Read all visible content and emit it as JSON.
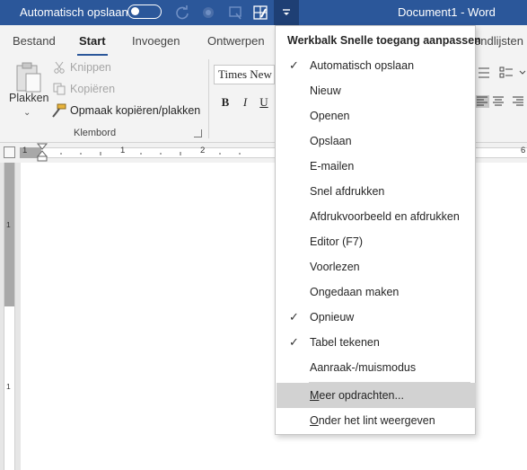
{
  "titlebar": {
    "autosave_label": "Automatisch opslaan",
    "autosave_state": "off",
    "document_title": "Document1  -  Word",
    "icons": [
      "redo-icon",
      "touch-mode-icon",
      "print-preview-icon",
      "table-draw-icon",
      "customize-qat-icon"
    ]
  },
  "ribbon": {
    "tabs": [
      {
        "label": "Bestand",
        "active": false
      },
      {
        "label": "Start",
        "active": true
      },
      {
        "label": "Invoegen",
        "active": false
      },
      {
        "label": "Ontwerpen",
        "active": false
      }
    ],
    "right_tab_fragment": "endlijsten",
    "clipboard": {
      "paste_label": "Plakken",
      "cut_label": "Knippen",
      "copy_label": "Kopiëren",
      "format_painter_label": "Opmaak kopiëren/plakken",
      "group_label": "Klembord"
    },
    "font": {
      "font_name": "Times New R",
      "bold": "B",
      "italic": "I",
      "underline": "U"
    }
  },
  "ruler": {
    "marks": [
      "1",
      "1",
      "2",
      "6"
    ]
  },
  "vruler": {
    "marks": [
      "1",
      "1"
    ]
  },
  "qat_menu": {
    "header": "Werkbalk Snelle toegang aanpassen",
    "items": [
      {
        "label": "Automatisch opslaan",
        "checked": true
      },
      {
        "label": "Nieuw",
        "checked": false
      },
      {
        "label": "Openen",
        "checked": false
      },
      {
        "label": "Opslaan",
        "checked": false
      },
      {
        "label": "E-mailen",
        "checked": false
      },
      {
        "label": "Snel afdrukken",
        "checked": false
      },
      {
        "label": "Afdrukvoorbeeld en afdrukken",
        "checked": false
      },
      {
        "label": "Editor (F7)",
        "checked": false
      },
      {
        "label": "Voorlezen",
        "checked": false
      },
      {
        "label": "Ongedaan maken",
        "checked": false
      },
      {
        "label": "Opnieuw",
        "checked": true
      },
      {
        "label": "Tabel tekenen",
        "checked": true
      },
      {
        "label": "Aanraak-/muismodus",
        "checked": false
      }
    ],
    "more_commands": "Meer opdrachten...",
    "show_below_ribbon": "Onder het lint weergeven"
  },
  "colors": {
    "titlebar": "#2b579a",
    "menu_hover": "#d2d2d2"
  }
}
